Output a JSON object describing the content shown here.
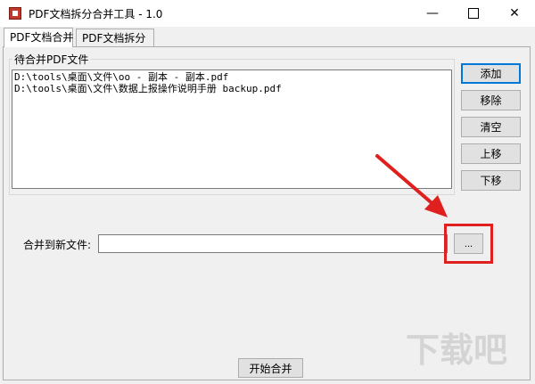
{
  "window": {
    "title": "PDF文档拆分合并工具 - 1.0",
    "minimize_glyph": "—",
    "close_glyph": "✕"
  },
  "tabs": [
    {
      "label": "PDF文档合并",
      "active": true
    },
    {
      "label": "PDF文档拆分",
      "active": false
    }
  ],
  "merge": {
    "group_label": "待合并PDF文件",
    "files": [
      "D:\\tools\\桌面\\文件\\oo - 副本 - 副本.pdf",
      "D:\\tools\\桌面\\文件\\数据上报操作说明手册 backup.pdf"
    ],
    "buttons": {
      "add": "添加",
      "remove": "移除",
      "clear": "清空",
      "move_up": "上移",
      "move_down": "下移"
    },
    "output_label": "合并到新文件:",
    "output_value": "",
    "browse_label": "...",
    "start_label": "开始合并"
  },
  "watermark": "下载吧",
  "colors": {
    "highlight": "#e0201e",
    "focus_border": "#0078d7"
  }
}
